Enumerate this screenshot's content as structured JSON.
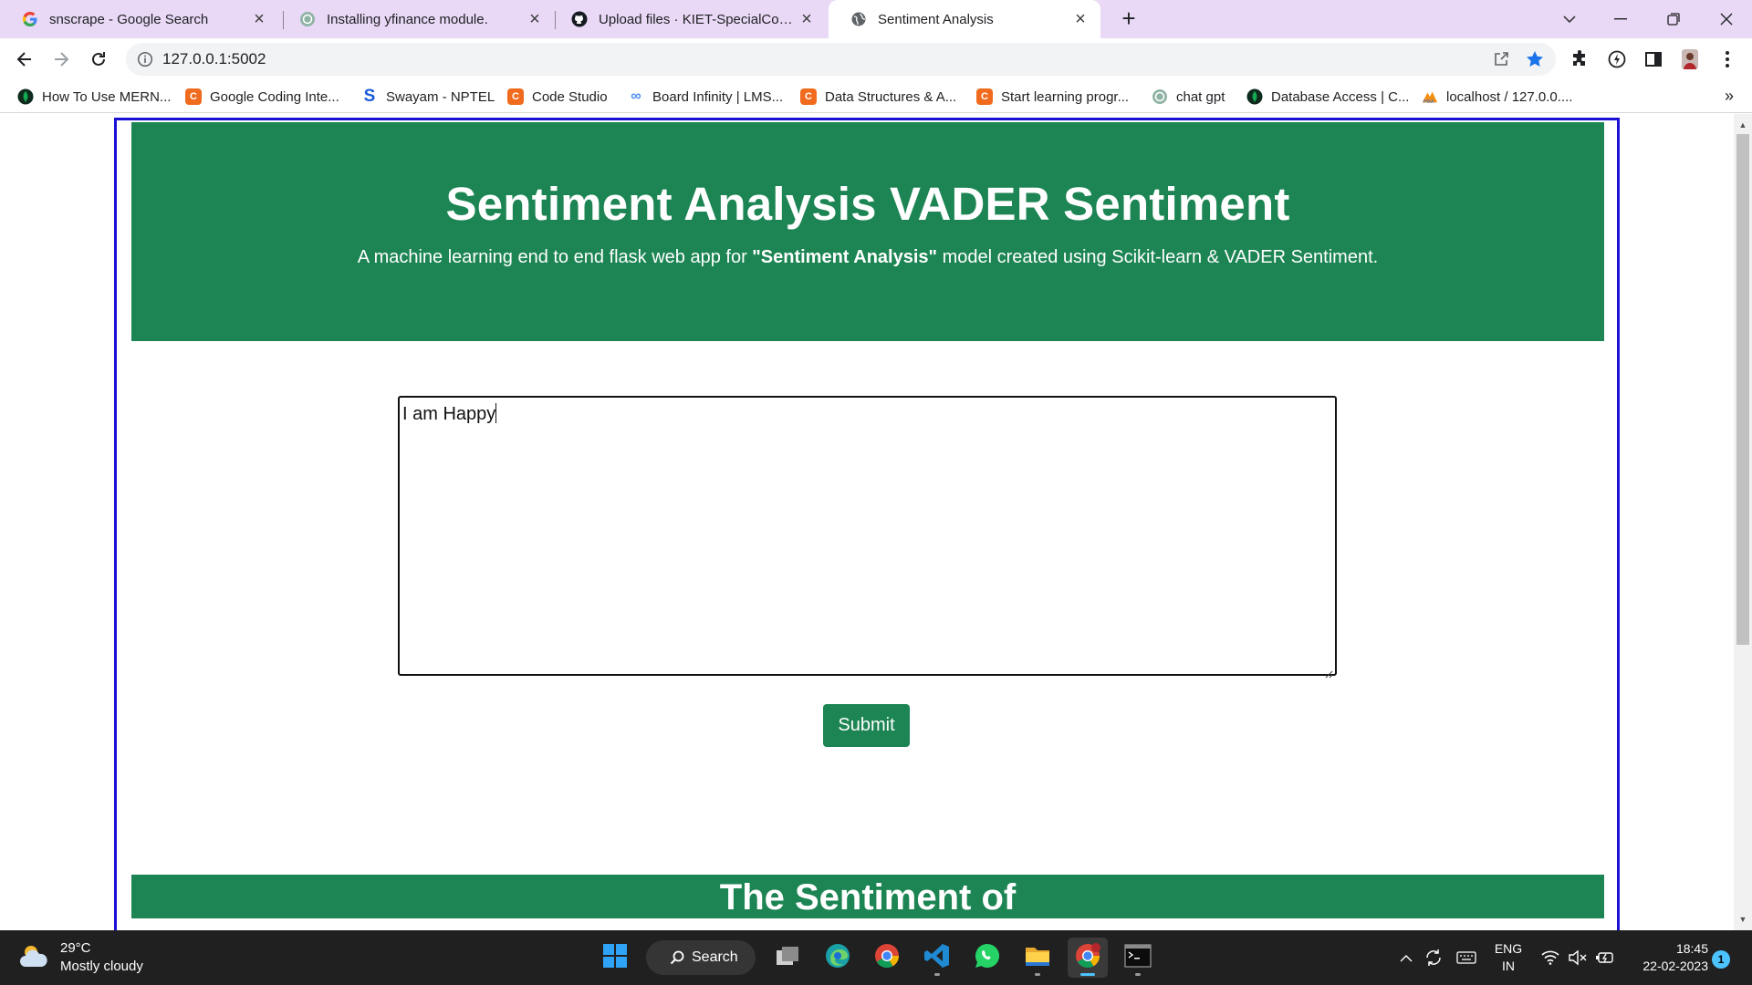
{
  "browser": {
    "tabs": [
      {
        "title": "snscrape - Google Search",
        "icon": "google-icon"
      },
      {
        "title": "Installing yfinance module.",
        "icon": "chatgpt-icon"
      },
      {
        "title": "Upload files · KIET-SpecialCoding",
        "icon": "github-icon"
      },
      {
        "title": "Sentiment Analysis",
        "icon": "globe-icon",
        "active": true
      }
    ],
    "address": "127.0.0.1:5002",
    "bookmarks": [
      {
        "label": "How To Use MERN...",
        "icon": "mongodb-icon"
      },
      {
        "label": "Google Coding Inte...",
        "icon": "codingninjas-icon"
      },
      {
        "label": "Swayam - NPTEL",
        "icon": "swayam-icon"
      },
      {
        "label": "Code Studio",
        "icon": "codingninjas-icon"
      },
      {
        "label": "Board Infinity | LMS...",
        "icon": "infinity-icon"
      },
      {
        "label": "Data Structures & A...",
        "icon": "codingninjas-icon"
      },
      {
        "label": "Start learning progr...",
        "icon": "codingninjas-icon"
      },
      {
        "label": "chat gpt",
        "icon": "chatgpt-icon"
      },
      {
        "label": "Database Access | C...",
        "icon": "mongodb-icon"
      },
      {
        "label": "localhost / 127.0.0....",
        "icon": "phpmyadmin-icon"
      }
    ],
    "bookmarks_more": "»"
  },
  "page": {
    "title": "Sentiment Analysis VADER Sentiment",
    "subtitle_before": "A machine learning end to end flask web app for ",
    "subtitle_bold": "\"Sentiment Analysis\"",
    "subtitle_after": " model created using Scikit-learn & VADER Sentiment.",
    "input_value": "I am Happy",
    "submit_label": "Submit",
    "result_heading": "The Sentiment of",
    "accent_color": "#1c8553",
    "frame_color": "#1a10d6"
  },
  "taskbar": {
    "weather_temp": "29°C",
    "weather_desc": "Mostly cloudy",
    "search_label": "Search",
    "lang_line1": "ENG",
    "lang_line2": "IN",
    "time": "18:45",
    "date": "22-02-2023",
    "notification_count": "1"
  }
}
